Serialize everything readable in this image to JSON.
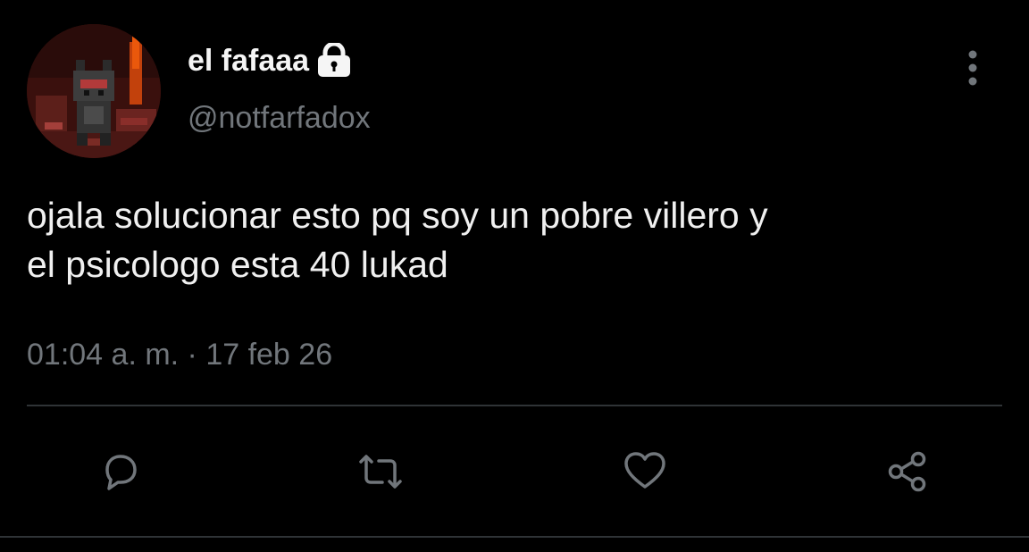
{
  "tweet": {
    "author": {
      "display_name": "el fafaaa",
      "handle": "@notfarfadox",
      "protected_icon": "lock-icon",
      "avatar": "pixel-art-fox-avatar"
    },
    "text": "ojala solucionar esto pq soy un pobre villero y\nel psicologo esta 40 lukad",
    "timestamp": "01:04 a. m. · 17 feb 26"
  },
  "menu": {
    "icon": "more-vertical-icon"
  },
  "actions": [
    {
      "name": "reply",
      "icon": "reply-icon"
    },
    {
      "name": "retweet",
      "icon": "retweet-icon"
    },
    {
      "name": "like",
      "icon": "heart-icon"
    },
    {
      "name": "share",
      "icon": "share-icon"
    }
  ],
  "colors": {
    "background": "#000000",
    "primary_text": "#e7e9ea",
    "secondary_text": "#71767b",
    "divider": "#2f3336"
  }
}
